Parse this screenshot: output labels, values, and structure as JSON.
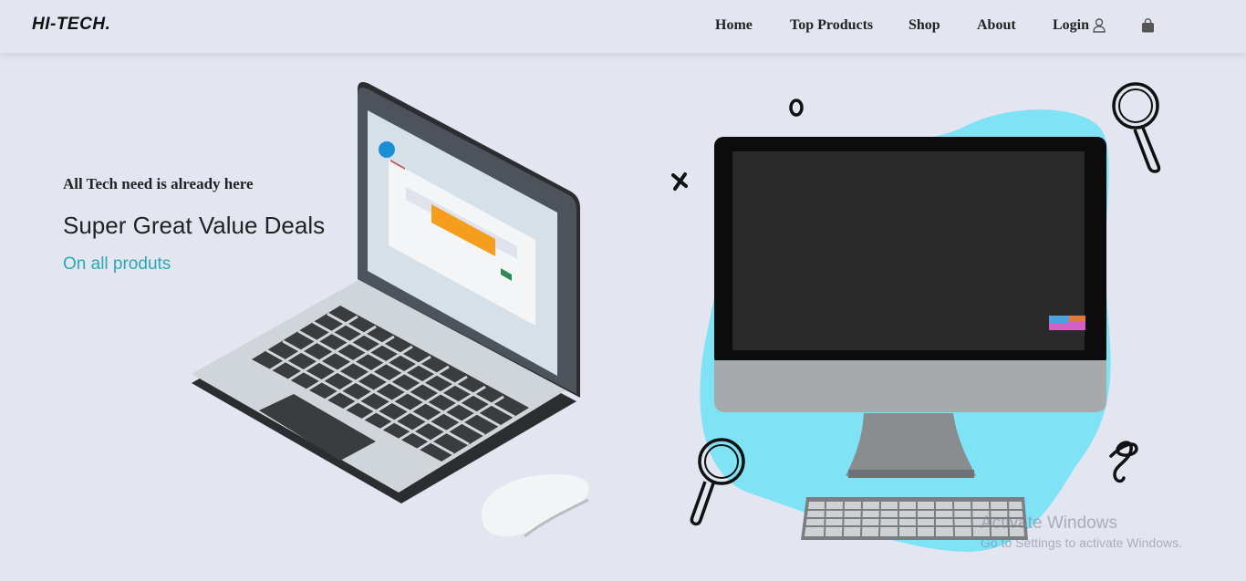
{
  "brand": "HI-TECH.",
  "nav": {
    "items": [
      {
        "label": "Home"
      },
      {
        "label": "Top Products"
      },
      {
        "label": "Shop"
      },
      {
        "label": "About"
      },
      {
        "label": "Login"
      }
    ],
    "icons": {
      "login": "user-icon",
      "cart": "shopping-bag-icon"
    }
  },
  "hero": {
    "tagline": "All Tech need is already here",
    "headline": "Super Great Value Deals",
    "subline": "On all produts"
  },
  "watermark": {
    "title": "Activate Windows",
    "subtitle": "Go to Settings to activate Windows."
  },
  "colors": {
    "background": "#e3e6f1",
    "accent": "#2aa8b4",
    "blob": "#7fe3f5"
  }
}
